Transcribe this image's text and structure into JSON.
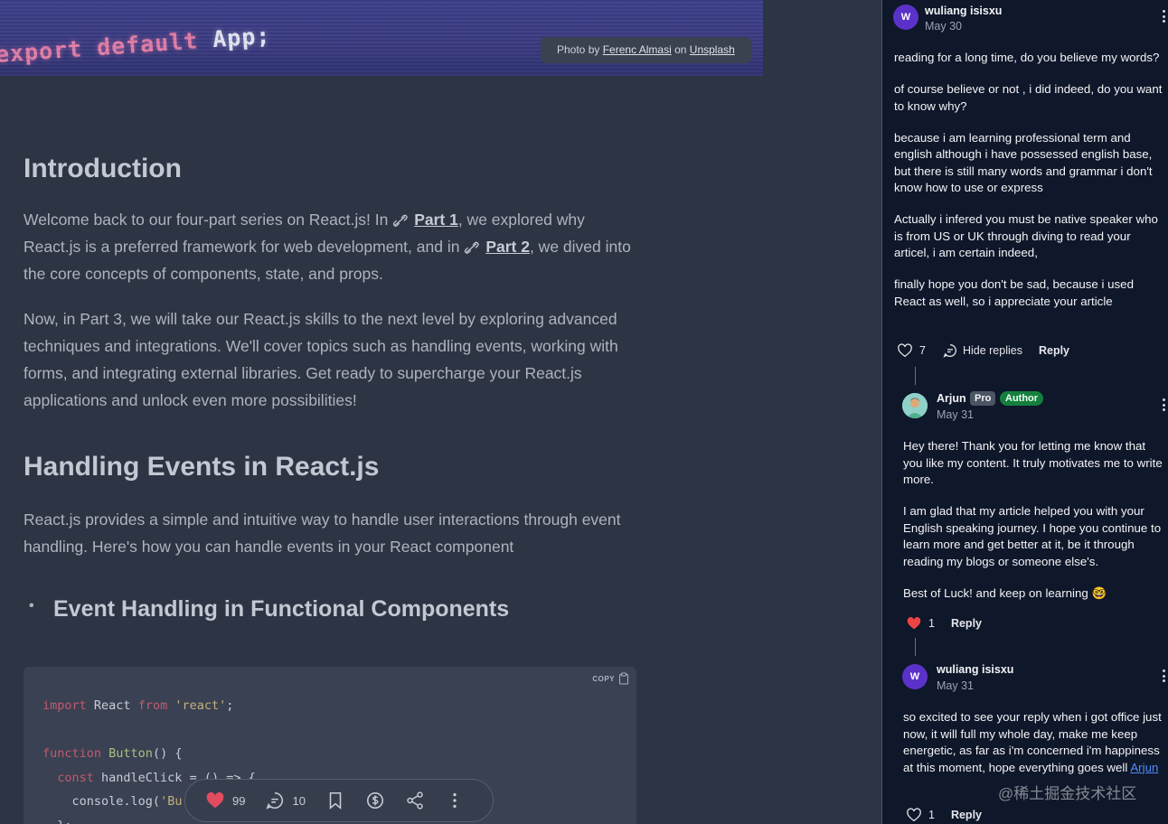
{
  "hero": {
    "code_text": "export default",
    "code_app": "App;",
    "credit_prefix": "Photo by",
    "credit_author": "Ferenc Almasi",
    "credit_on": "on",
    "credit_source": "Unsplash"
  },
  "article": {
    "intro_heading": "Introduction",
    "p1_a": "Welcome back to our four-part series on React.js! In ",
    "p1_link1": "Part 1",
    "p1_b": ", we explored why React.js is a preferred framework for web development, and in ",
    "p1_link2": "Part 2",
    "p1_c": ", we dived into the core concepts of components, state, and props.",
    "p2": "Now, in Part 3, we will take our React.js skills to the next level by exploring advanced techniques and integrations. We'll cover topics such as handling events, working with forms, and integrating external libraries. Get ready to supercharge your React.js applications and unlock even more possibilities!",
    "h2": "Handling Events in React.js",
    "p3": "React.js provides a simple and intuitive way to handle user interactions through event handling. Here's how you can handle events in your React component",
    "h3": "Event Handling in Functional Components",
    "copy_label": "COPY"
  },
  "code": {
    "l1_kw1": "import",
    "l1_mid": " React ",
    "l1_kw2": "from",
    "l1_str": "'react'",
    "l1_end": ";",
    "l2_kw": "function",
    "l2_fn": "Button",
    "l2_end": "() {",
    "l3_kw": "const",
    "l3_end": " handleClick = () => {",
    "l4_a": "console.log(",
    "l4_str": "'Bu",
    "l5": "};"
  },
  "floatbar": {
    "likes": "99",
    "comments": "10"
  },
  "comments": {
    "c1": {
      "avatar": "W",
      "name": "wuliang isisxu",
      "date": "May 30",
      "paragraphs": [
        "reading for a long time, do you believe my words?",
        "of course believe or not , i did indeed, do you want to know why?",
        "because i am learning professional term and english although i have possessed english base, but there is still many words and grammar i don't know how to use or express",
        "Actually i infered you must be native speaker who is from US or UK through diving to read your articel, i am certain indeed,",
        "finally hope you don't be sad, because i used React as well, so i appreciate your article"
      ],
      "likes": "7",
      "hide_replies": "Hide replies",
      "reply": "Reply"
    },
    "c2": {
      "name": "Arjun",
      "badge_pro": "Pro",
      "badge_author": "Author",
      "date": "May 31",
      "paragraphs": [
        "Hey there! Thank you for letting me know that you like my content. It truly motivates me to write more.",
        "I am glad that my article helped you with your English speaking journey. I hope you continue to learn more and get better at it, be it through reading my blogs or someone else's.",
        "Best of Luck! and keep on learning 🤓"
      ],
      "likes": "1",
      "reply": "Reply"
    },
    "c3": {
      "avatar": "W",
      "name": "wuliang isisxu",
      "date": "May 31",
      "text": "so excited to see your reply when i got office just now, it will full my whole day, make me keep energetic, as far as i'm concerned i'm happiness at this moment, hope everything goes well ",
      "mention": "Arjun",
      "likes": "1",
      "reply": "Reply"
    }
  },
  "watermark": "@稀土掘金技术社区",
  "colors": {
    "article_bg": "#2d3444",
    "comments_bg": "#0f172a",
    "author_badge": "#15803d",
    "liked_heart": "#ef4444",
    "mention_link": "#4f8dff"
  }
}
